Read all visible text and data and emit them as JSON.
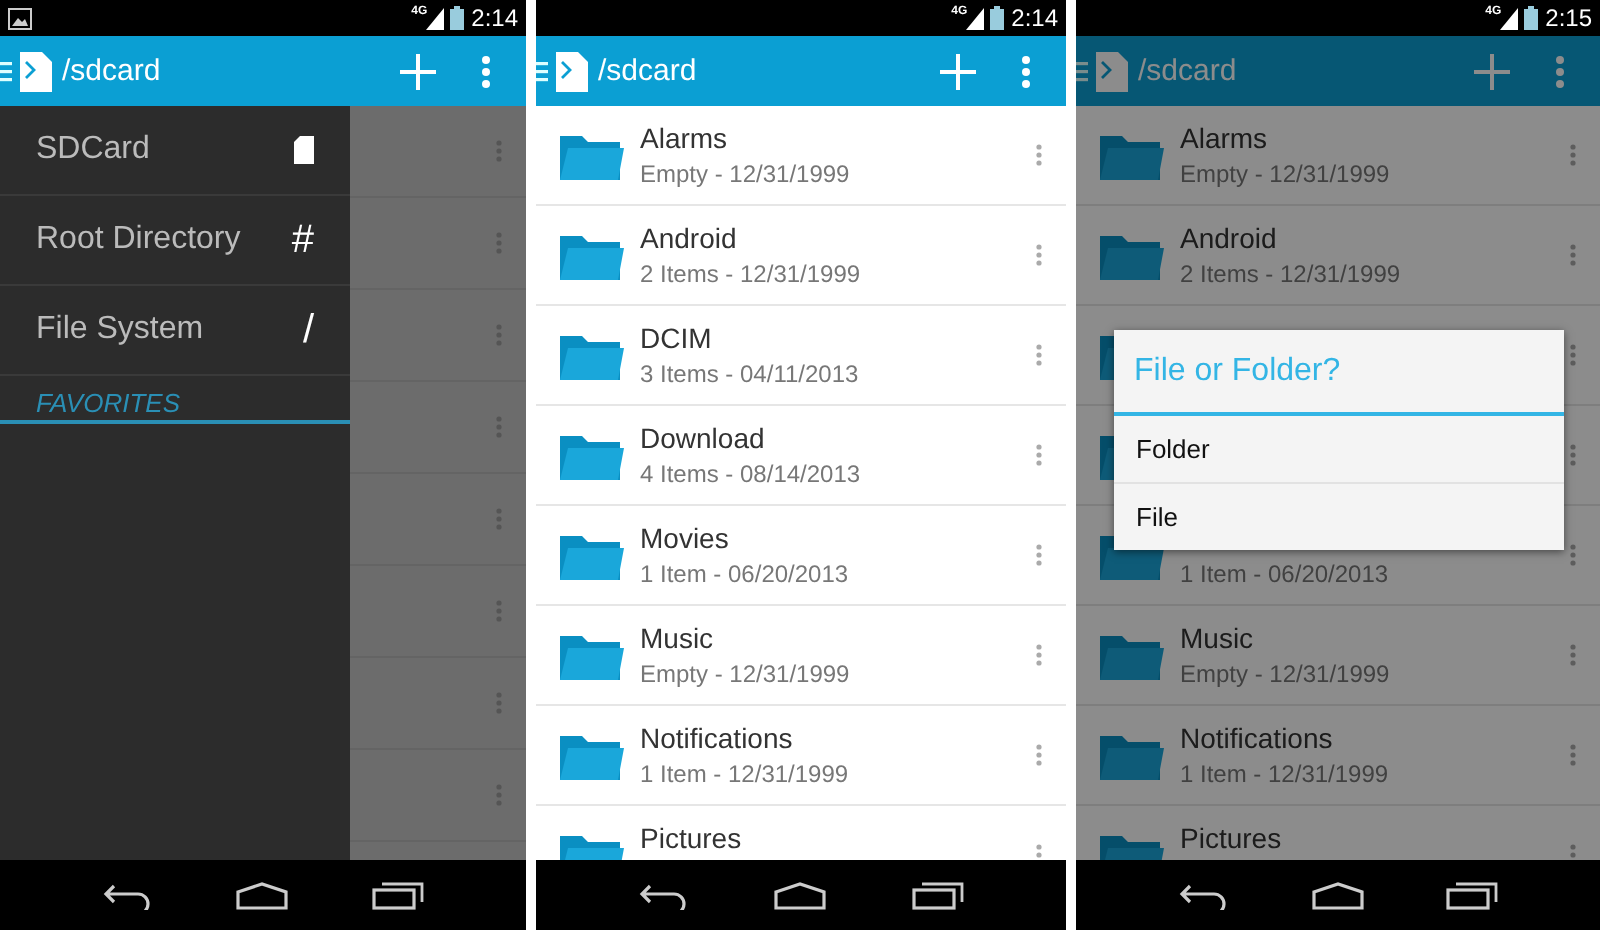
{
  "screens": [
    {
      "kind": "drawer",
      "status_bar": {
        "notification": true,
        "network": "4G",
        "time": "2:14"
      },
      "action_bar": {
        "path": "/sdcard"
      },
      "drawer": {
        "items": [
          {
            "label": "SDCard",
            "kind": "sdcard"
          },
          {
            "label": "Root Directory",
            "kind": "symbol",
            "symbol": "#"
          },
          {
            "label": "File System",
            "kind": "symbol",
            "symbol": "/"
          }
        ],
        "section": "FAVORITES"
      }
    },
    {
      "kind": "list",
      "status_bar": {
        "notification": false,
        "network": "4G",
        "time": "2:14"
      },
      "action_bar": {
        "path": "/sdcard"
      },
      "folders": [
        {
          "kind": "folder",
          "name": "Alarms",
          "info": "Empty - 12/31/1999"
        },
        {
          "kind": "folder",
          "name": "Android",
          "info": "2 Items - 12/31/1999"
        },
        {
          "kind": "folder",
          "name": "DCIM",
          "info": "3 Items - 04/11/2013"
        },
        {
          "kind": "folder",
          "name": "Download",
          "info": "4 Items - 08/14/2013"
        },
        {
          "kind": "folder",
          "name": "Movies",
          "info": "1 Item - 06/20/2013"
        },
        {
          "kind": "folder",
          "name": "Music",
          "info": "Empty - 12/31/1999"
        },
        {
          "kind": "folder",
          "name": "Notifications",
          "info": "1 Item - 12/31/1999"
        },
        {
          "kind": "folder",
          "name": "Pictures"
        }
      ]
    },
    {
      "kind": "dialog",
      "status_bar": {
        "notification": false,
        "network": "4G",
        "time": "2:15"
      },
      "action_bar": {
        "path": "/sdcard"
      },
      "folders": [
        {
          "kind": "folder",
          "name": "Alarms",
          "info": "Empty - 12/31/1999"
        },
        {
          "kind": "folder",
          "name": "Android",
          "info": "2 Items - 12/31/1999"
        },
        {
          "kind": "folder"
        },
        {
          "kind": "folder"
        },
        {
          "kind": "folder",
          "info": "1 Item - 06/20/2013"
        },
        {
          "kind": "folder",
          "name": "Music",
          "info": "Empty - 12/31/1999"
        },
        {
          "kind": "folder",
          "name": "Notifications",
          "info": "1 Item - 12/31/1999"
        },
        {
          "kind": "folder",
          "name": "Pictures"
        }
      ],
      "dialog": {
        "title": "File or Folder?",
        "options": [
          "Folder",
          "File"
        ]
      }
    }
  ]
}
